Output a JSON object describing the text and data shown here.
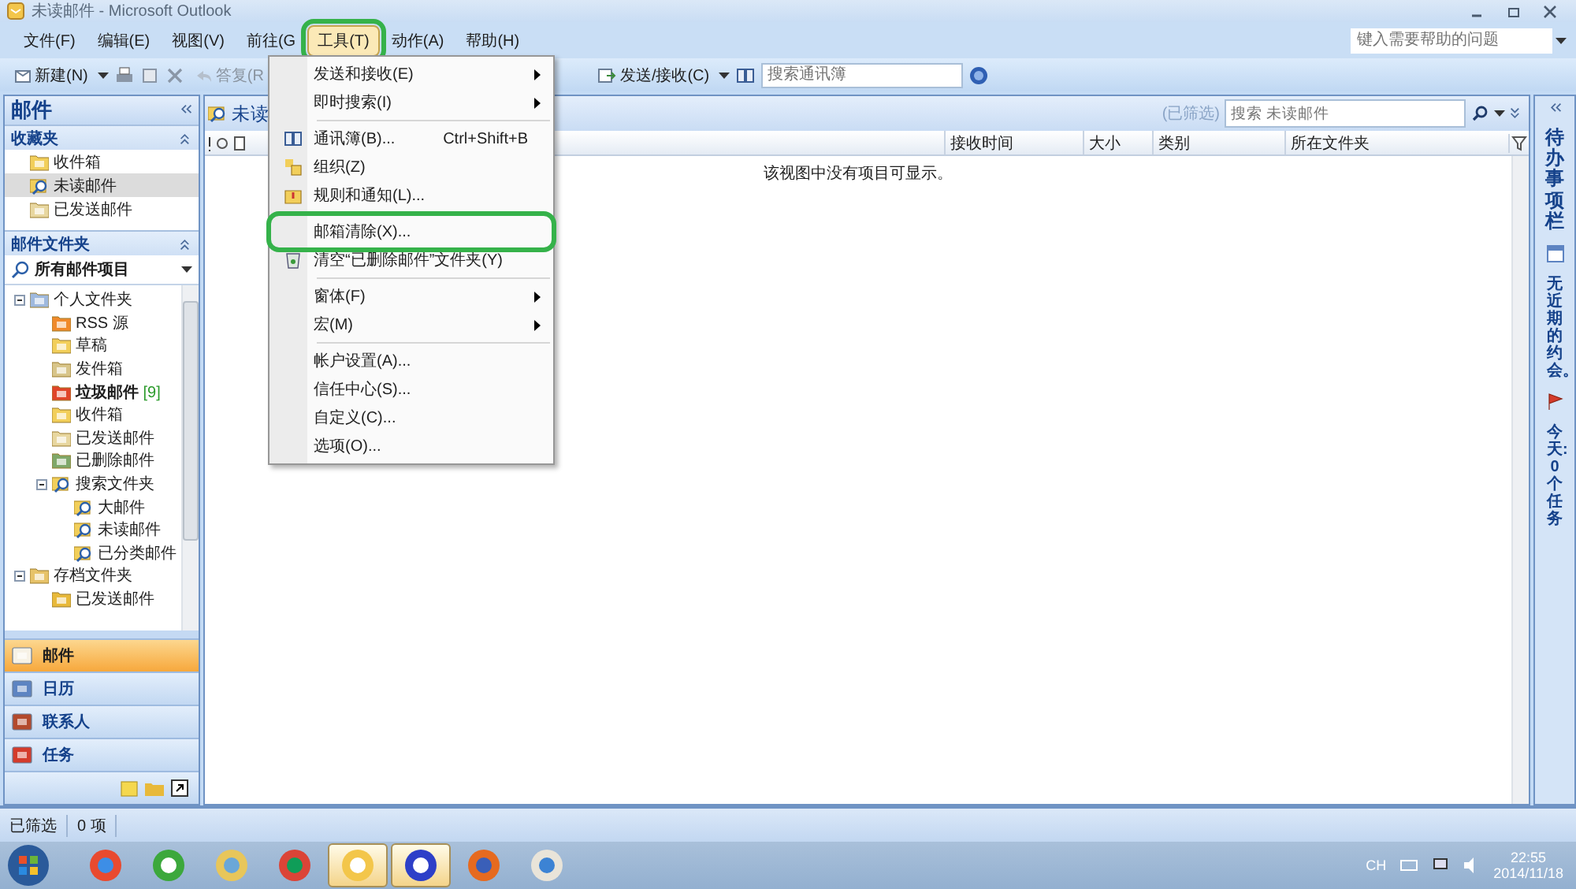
{
  "window": {
    "title": "未读邮件 - Microsoft Outlook"
  },
  "menu_bar": [
    {
      "label": "文件(F)",
      "selected": false,
      "circled": false
    },
    {
      "label": "编辑(E)",
      "selected": false,
      "circled": false
    },
    {
      "label": "视图(V)",
      "selected": false,
      "circled": false
    },
    {
      "label": "前往(G",
      "selected": false,
      "circled": false
    },
    {
      "label": "工具(T)",
      "selected": true,
      "circled": true
    },
    {
      "label": "动作(A)",
      "selected": false,
      "circled": false
    },
    {
      "label": "帮助(H)",
      "selected": false,
      "circled": false
    }
  ],
  "help_box": {
    "placeholder": "键入需要帮助的问题"
  },
  "toolbar": {
    "new": "新建(N)",
    "reply": "答复(R",
    "send_receive": "发送/接收(C)",
    "address_search": {
      "placeholder": "搜索通讯簿"
    }
  },
  "tools_menu": [
    {
      "kind": "item",
      "label": "发送和接收(E)",
      "submenu": true,
      "circled": false
    },
    {
      "kind": "item",
      "label": "即时搜索(I)",
      "submenu": true,
      "circled": false
    },
    {
      "kind": "separator"
    },
    {
      "kind": "item",
      "label": "通讯簿(B)...",
      "shortcut": "Ctrl+Shift+B",
      "submenu": false,
      "circled": false
    },
    {
      "kind": "item",
      "label": "组织(Z)",
      "submenu": false,
      "circled": false
    },
    {
      "kind": "item",
      "label": "规则和通知(L)...",
      "submenu": false,
      "circled": false
    },
    {
      "kind": "separator"
    },
    {
      "kind": "item",
      "label": "邮箱清除(X)...",
      "submenu": false,
      "circled": true
    },
    {
      "kind": "item",
      "label": "清空“已删除邮件”文件夹(Y)",
      "submenu": false,
      "circled": false
    },
    {
      "kind": "separator"
    },
    {
      "kind": "item",
      "label": "窗体(F)",
      "submenu": true,
      "circled": false
    },
    {
      "kind": "item",
      "label": "宏(M)",
      "submenu": true,
      "circled": false
    },
    {
      "kind": "separator"
    },
    {
      "kind": "item",
      "label": "帐户设置(A)...",
      "submenu": false,
      "circled": false
    },
    {
      "kind": "item",
      "label": "信任中心(S)...",
      "submenu": false,
      "circled": false
    },
    {
      "kind": "item",
      "label": "自定义(C)...",
      "submenu": false,
      "circled": false
    },
    {
      "kind": "item",
      "label": "选项(O)...",
      "submenu": false,
      "circled": false
    }
  ],
  "sidebar": {
    "title": "邮件",
    "favorites": {
      "title": "收藏夹",
      "items": [
        {
          "label": "收件箱",
          "selected": false
        },
        {
          "label": "未读邮件",
          "selected": true
        },
        {
          "label": "已发送邮件",
          "selected": false
        }
      ]
    },
    "folders_title": "邮件文件夹",
    "folder_view": "所有邮件项目",
    "tree": [
      {
        "label": "个人文件夹",
        "expanded": true,
        "children": [
          {
            "label": "RSS 源",
            "bold": false
          },
          {
            "label": "草稿",
            "bold": false
          },
          {
            "label": "发件箱",
            "bold": false
          },
          {
            "label": "垃圾邮件",
            "count": "[9]",
            "bold": true
          },
          {
            "label": "收件箱",
            "bold": false
          },
          {
            "label": "已发送邮件",
            "bold": false
          },
          {
            "label": "已删除邮件",
            "bold": false
          },
          {
            "label": "搜索文件夹",
            "expanded": true,
            "children": [
              {
                "label": "大邮件",
                "bold": false
              },
              {
                "label": "未读邮件",
                "bold": false
              },
              {
                "label": "已分类邮件",
                "bold": false
              }
            ]
          }
        ]
      },
      {
        "label": "存档文件夹",
        "expanded": true,
        "children": [
          {
            "label": "已发送邮件",
            "bold": false
          }
        ]
      }
    ],
    "nav": [
      {
        "label": "邮件",
        "selected": true
      },
      {
        "label": "日历",
        "selected": false
      },
      {
        "label": "联系人",
        "selected": false
      },
      {
        "label": "任务",
        "selected": false
      }
    ]
  },
  "message_list": {
    "title": "未读",
    "filter_note": "(已筛选)",
    "search": {
      "placeholder": "搜索 未读邮件"
    },
    "columns": [
      "接收时间",
      "大小",
      "类别",
      "所在文件夹"
    ],
    "empty_text": "该视图中没有项目可显示。"
  },
  "todo_bar": {
    "title": "待办事项栏",
    "appointments": "无近期的约会。",
    "tasks": "今天: 0 个任务"
  },
  "status_bar": [
    "已筛选",
    "0 项"
  ],
  "taskbar": {
    "apps": [
      {
        "selected": false
      },
      {
        "selected": false
      },
      {
        "selected": false
      },
      {
        "selected": false
      },
      {
        "selected": true
      },
      {
        "selected": true
      },
      {
        "selected": false
      },
      {
        "selected": false
      }
    ],
    "language": "CH",
    "time": "22:55",
    "date": "2014/11/18"
  }
}
